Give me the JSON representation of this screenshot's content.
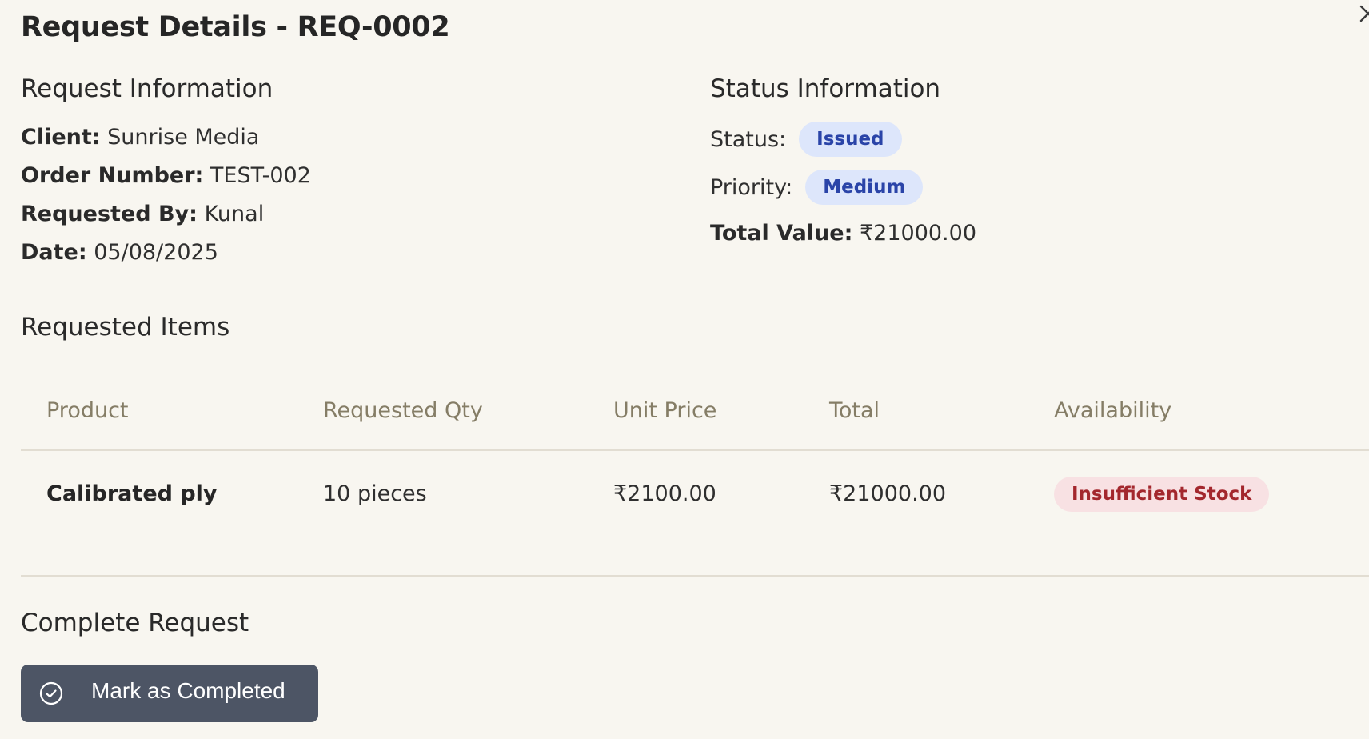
{
  "dialog": {
    "title": "Request Details - REQ-0002",
    "close_icon": "close-icon"
  },
  "request_info": {
    "heading": "Request Information",
    "client_label": "Client:",
    "client_value": "Sunrise Media",
    "order_label": "Order Number:",
    "order_value": "TEST-002",
    "requested_by_label": "Requested By:",
    "requested_by_value": "Kunal",
    "date_label": "Date:",
    "date_value": "05/08/2025"
  },
  "status_info": {
    "heading": "Status Information",
    "status_label": "Status:",
    "status_value": "Issued",
    "priority_label": "Priority:",
    "priority_value": "Medium",
    "total_label": "Total Value:",
    "total_value": "₹21000.00"
  },
  "items": {
    "heading": "Requested Items",
    "columns": [
      "Product",
      "Requested Qty",
      "Unit Price",
      "Total",
      "Availability"
    ],
    "rows": [
      {
        "product": "Calibrated ply",
        "qty": "10 pieces",
        "unit_price": "₹2100.00",
        "total": "₹21000.00",
        "availability": "Insufficient Stock"
      }
    ]
  },
  "complete": {
    "heading": "Complete Request",
    "button_label": "Mark as Completed",
    "button_icon": "check-circle-icon"
  },
  "colors": {
    "background": "#f8f6f0",
    "badge_blue_bg": "#dde6fb",
    "badge_blue_text": "#2a44a8",
    "badge_red_bg": "#f8e1e3",
    "badge_red_text": "#a3272d",
    "button_bg": "#4d5565"
  }
}
